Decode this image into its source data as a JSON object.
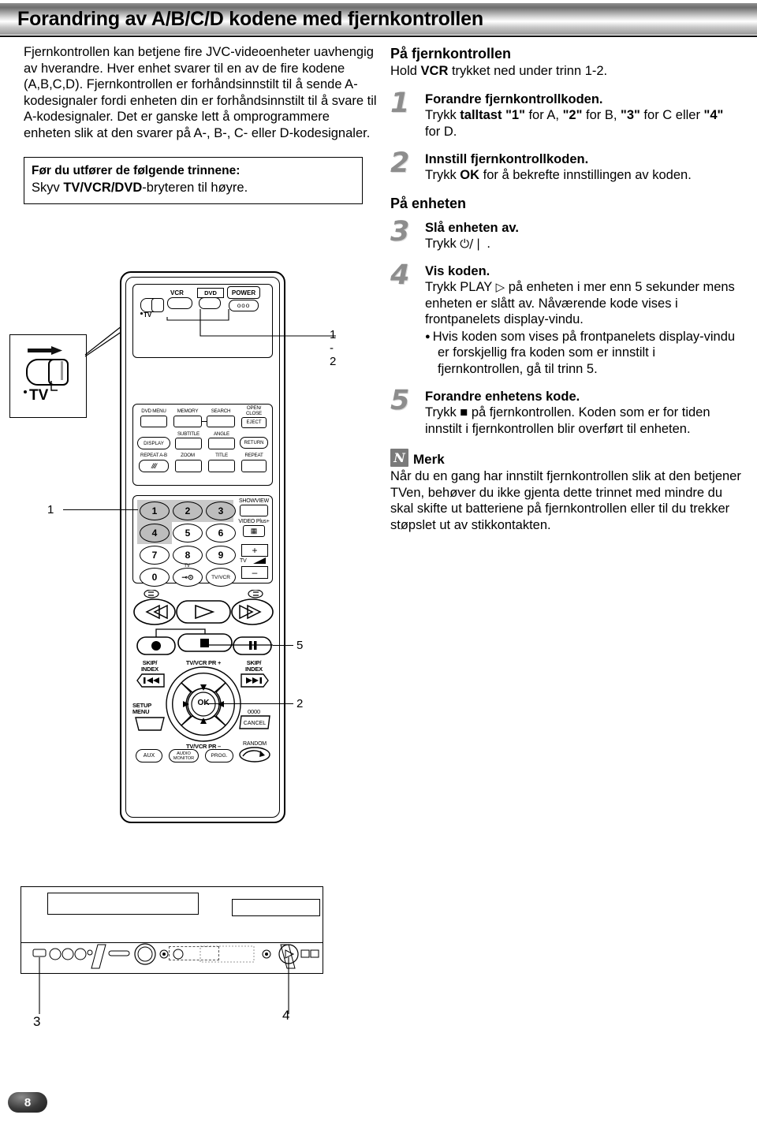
{
  "header": {
    "title": "Forandring av A/B/C/D kodene med fjernkontrollen"
  },
  "left": {
    "intro": "Fjernkontrollen kan betjene fire JVC-videoenheter uavhengig av hverandre. Hver enhet svarer til en av de fire kodene (A,B,C,D). Fjernkontrollen er forhåndsinnstilt til å sende A-kodesignaler fordi enheten din er forhåndsinnstilt til å svare til A-kodesignaler. Det er ganske lett å omprogrammere enheten slik at den svarer på A-, B-, C- eller D-kodesignaler.",
    "prebox": {
      "heading": "Før du utfører de følgende trinnene:",
      "line_pre": "Skyv ",
      "line_bold": "TV/VCR/DVD",
      "line_post": "-bryteren til høyre."
    }
  },
  "right": {
    "remote_heading": "På fjernkontrollen",
    "remote_sub_pre": "Hold ",
    "remote_sub_bold": "VCR",
    "remote_sub_post": " trykket ned under trinn 1-2.",
    "unit_heading": "På enheten",
    "steps": [
      {
        "num": "1",
        "title": "Forandre fjernkontrollkoden.",
        "l1_pre": "Trykk ",
        "l1_b1": "talltast \"1\"",
        "l1_m1": " for A, ",
        "l1_b2": "\"2\"",
        "l1_m2": " for B, ",
        "l1_b3": "\"3\"",
        "l1_m3": " for C eller ",
        "l1_b4": "\"4\"",
        "l2": "for D."
      },
      {
        "num": "2",
        "title": "Innstill fjernkontrollkoden.",
        "l1_pre": "Trykk ",
        "l1_b1": "OK",
        "l1_post": " for å bekrefte innstillingen av koden."
      },
      {
        "num": "3",
        "title": "Slå enheten av.",
        "l1_pre": "Trykk ",
        "l1_glyph": "⏻/❘",
        "l1_post": " ."
      },
      {
        "num": "4",
        "title": "Vis koden.",
        "l1_pre": "Trykk PLAY ",
        "l1_glyph": "▷",
        "l1_post": " på enheten i mer enn 5 sekunder mens enheten er slått av. Nåværende kode vises i frontpanelets display-vindu.",
        "bullet": "Hvis koden som vises på frontpanelets display-vindu er forskjellig fra koden som er innstilt i fjernkontrollen, gå til trinn 5."
      },
      {
        "num": "5",
        "title": "Forandre enhetens kode.",
        "l1_pre": "Trykk ",
        "l1_glyph": "■",
        "l1_post": " på fjernkontrollen. Koden som er for tiden innstilt i fjernkontrollen blir overført til enheten."
      }
    ],
    "note": {
      "badge": "N",
      "word": "Merk",
      "text": "Når du en gang har innstilt fjernkontrollen slik at den betjener TVen, behøver du ikke gjenta dette trinnet med mindre du skal skifte ut batteriene på fjernkontrollen eller til du trekker støpslet ut av stikkontakten."
    }
  },
  "figure": {
    "tv_switch_label": "TV",
    "callouts": {
      "c12": "1 - 2",
      "c1": "1",
      "c5": "5",
      "c2": "2",
      "c3": "3",
      "c4": "4"
    },
    "remote": {
      "top_row": [
        "VCR",
        "DVD",
        "POWER"
      ],
      "power_sub": "ooo",
      "tv_switch": "TV",
      "dvd_rows": [
        [
          "DVD MENU",
          "MEMORY",
          "SEARCH",
          "OPEN/",
          "CLOSE",
          "EJECT"
        ],
        [
          "DISPLAY",
          "SUBTITLE",
          "ANGLE",
          "RETURN"
        ],
        [
          "REPEAT A-B",
          "ZOOM",
          "TITLE",
          "REPEAT"
        ]
      ],
      "dvd_menu": "DVD MENU",
      "memory": "MEMORY",
      "search": "SEARCH",
      "open": "OPEN/",
      "close": "CLOSE",
      "eject": "EJECT",
      "display": "DISPLAY",
      "subtitle": "SUBTITLE",
      "angle": "ANGLE",
      "return": "RETURN",
      "repeat_ab": "REPEAT A-B",
      "zoom": "ZOOM",
      "title": "TITLE",
      "repeat": "REPEAT",
      "keys": [
        "1",
        "2",
        "3",
        "4",
        "5",
        "6",
        "7",
        "8",
        "9",
        "0"
      ],
      "highlighted_keys": [
        "1",
        "2",
        "3",
        "4"
      ],
      "key_tv": "TV",
      "key_tvvcr": "TV/VCR",
      "showview": "SHOWVIEW",
      "videoplus": "VIDEO Plus+",
      "vol_plus": "+",
      "vol_minus": "–",
      "vol_tv": "TV",
      "skip_index": "SKIP/\nINDEX",
      "skip_label_1": "SKIP/",
      "skip_label_2": "INDEX",
      "ok": "OK",
      "pr_plus": "TV/VCR  PR +",
      "pr_minus": "TV/VCR  PR –",
      "setup_menu_1": "SETUP",
      "setup_menu_2": "MENU",
      "cancel": "CANCEL",
      "cancel_top": "0000",
      "aux": "AUX",
      "audio_1": "AUDIO",
      "audio_2": "MONITOR",
      "prog": "PROG.",
      "random": "RANDOM"
    }
  },
  "footer": {
    "page": "8"
  }
}
